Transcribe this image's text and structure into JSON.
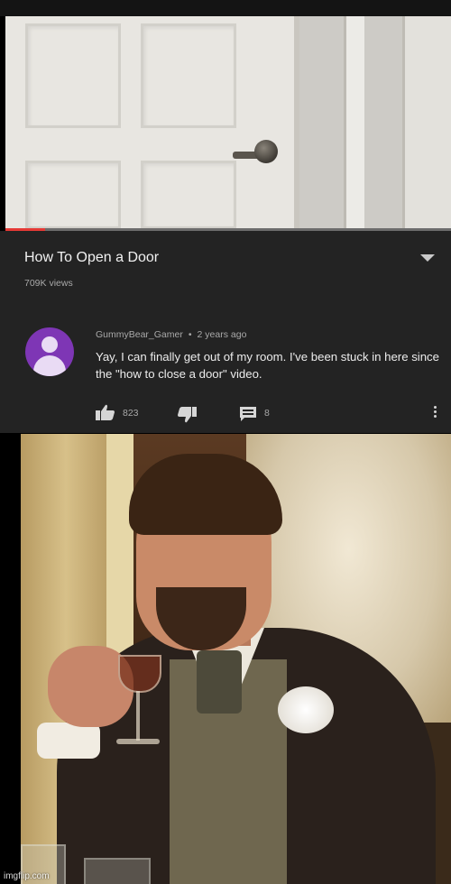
{
  "video": {
    "progress": 0.09
  },
  "info": {
    "title": "How To Open a Door",
    "views": "709K views",
    "expand_icon": "chevron-down-icon"
  },
  "comment": {
    "username": "GummyBear_Gamer",
    "separator": "•",
    "time": "2 years ago",
    "text": "Yay, I can finally get out of my room. I've been stuck in here since the \"how to close a door\" video.",
    "likes": "823",
    "replies": "8",
    "avatar_color": "#7e36b5"
  },
  "watermark": "imgflip.com"
}
